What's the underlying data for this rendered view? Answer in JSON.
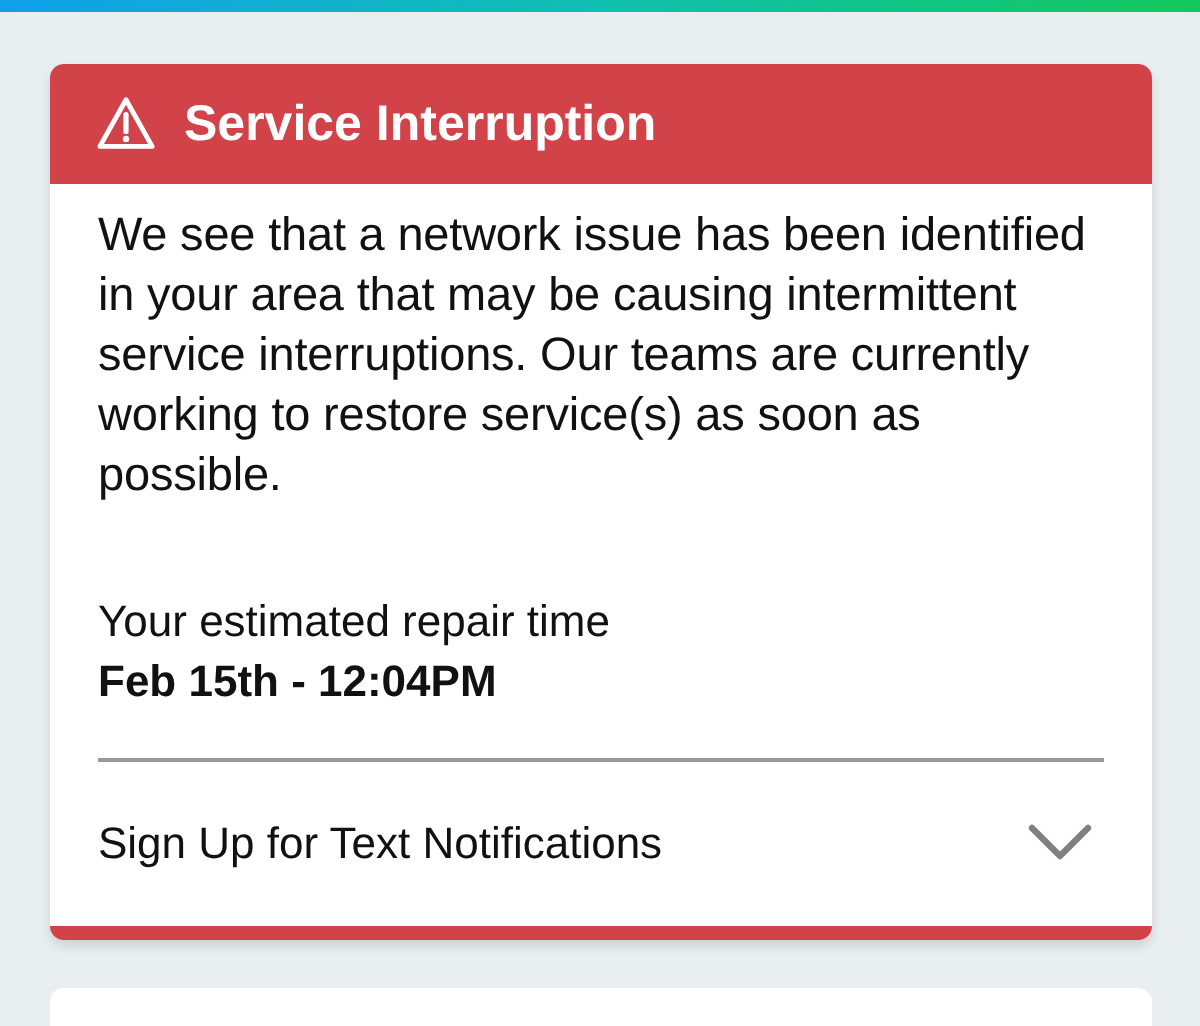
{
  "alert": {
    "title": "Service Interruption",
    "message": "We see that a network issue has been identified in your area that may be causing intermittent service interruptions. Our teams are currently working to restore service(s) as soon as possible.",
    "repair_label": "Your estimated repair time",
    "repair_time": "Feb 15th - 12:04PM",
    "notifications": {
      "label": "Sign Up for Text Notifications",
      "expanded": false
    }
  }
}
